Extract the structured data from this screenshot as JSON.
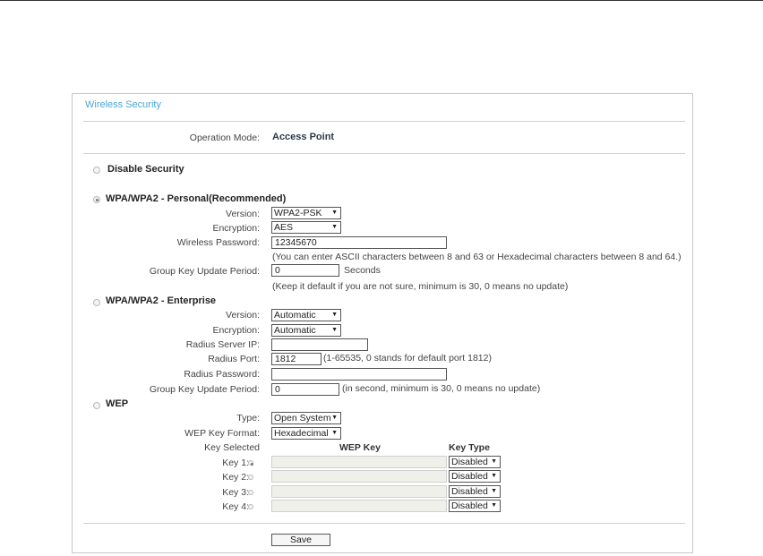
{
  "panel": {
    "title": "Wireless Security"
  },
  "operation_mode": {
    "label": "Operation Mode:",
    "value": "Access Point"
  },
  "disable_security": {
    "label": "Disable Security",
    "selected": false
  },
  "wpa_personal": {
    "label": "WPA/WPA2 - Personal(Recommended)",
    "selected": true,
    "version_label": "Version:",
    "version_value": "WPA2-PSK",
    "encryption_label": "Encryption:",
    "encryption_value": "AES",
    "password_label": "Wireless Password:",
    "password_value": "12345670",
    "password_hint": "(You can enter ASCII characters between 8 and 63 or Hexadecimal characters between 8 and 64.)",
    "group_key_label": "Group Key Update Period:",
    "group_key_value": "0",
    "group_key_unit": "Seconds",
    "group_key_hint": "(Keep it default if you are not sure, minimum is 30, 0 means no update)"
  },
  "wpa_enterprise": {
    "label": "WPA/WPA2 - Enterprise",
    "selected": false,
    "version_label": "Version:",
    "version_value": "Automatic",
    "encryption_label": "Encryption:",
    "encryption_value": "Automatic",
    "radius_ip_label": "Radius Server IP:",
    "radius_ip_value": "",
    "radius_port_label": "Radius Port:",
    "radius_port_value": "1812",
    "radius_port_hint": "(1-65535, 0 stands for default port 1812)",
    "radius_password_label": "Radius Password:",
    "radius_password_value": "",
    "group_key_label": "Group Key Update Period:",
    "group_key_value": "0",
    "group_key_hint": "(in second, minimum is 30, 0 means no update)"
  },
  "wep": {
    "label": "WEP",
    "selected": false,
    "type_label": "Type:",
    "type_value": "Open System",
    "key_format_label": "WEP Key Format:",
    "key_format_value": "Hexadecimal",
    "key_selected_header": "Key Selected",
    "wep_key_header": "WEP Key",
    "key_type_header": "Key Type",
    "keys": [
      {
        "label": "Key 1:",
        "selected": true,
        "value": "",
        "type": "Disabled"
      },
      {
        "label": "Key 2:",
        "selected": false,
        "value": "",
        "type": "Disabled"
      },
      {
        "label": "Key 3:",
        "selected": false,
        "value": "",
        "type": "Disabled"
      },
      {
        "label": "Key 4:",
        "selected": false,
        "value": "",
        "type": "Disabled"
      }
    ]
  },
  "save_button": {
    "label": "Save"
  },
  "icons": {
    "dropdown": "dropdown-arrow-icon",
    "radio": "radio-icon"
  },
  "colors": {
    "title": "#4aa6d6",
    "border": "#c6c6c6",
    "disabled_field": "#f0f0ea"
  }
}
